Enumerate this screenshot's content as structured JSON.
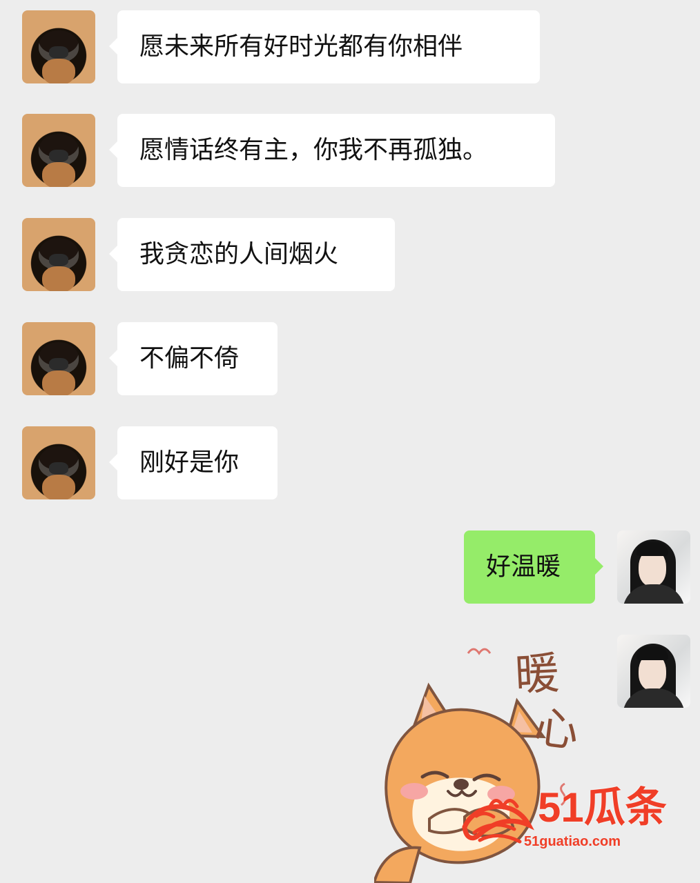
{
  "messages": [
    {
      "side": "left",
      "sender": "dog",
      "text": "愿未来所有好时光都有你相伴"
    },
    {
      "side": "left",
      "sender": "dog",
      "text": "愿情话终有主，你我不再孤独。"
    },
    {
      "side": "left",
      "sender": "dog",
      "text": "我贪恋的人间烟火"
    },
    {
      "side": "left",
      "sender": "dog",
      "text": "不偏不倚"
    },
    {
      "side": "left",
      "sender": "dog",
      "text": "刚好是你"
    },
    {
      "side": "right",
      "sender": "girl",
      "text": "好温暖"
    }
  ],
  "sticker": {
    "top_text": "暖",
    "bottom_text": "心",
    "colors": {
      "text": "#8a4e36",
      "dog_orange": "#f3a85e",
      "dog_light": "#fff3df",
      "blush": "#f6a6a4"
    }
  },
  "watermark": {
    "brand": "51瓜条",
    "url": "51guatiao.com",
    "color": "#f03e27"
  },
  "colors": {
    "background": "#ededed",
    "left_bubble": "#ffffff",
    "right_bubble": "#95ec69",
    "text": "#111111"
  },
  "icons": {
    "left_avatar": "shiba-dog-avatar",
    "right_avatar": "girl-avatar"
  }
}
